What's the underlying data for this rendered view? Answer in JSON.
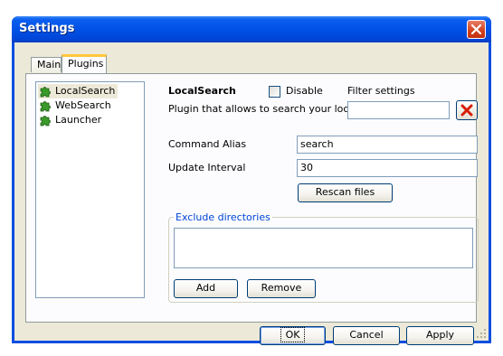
{
  "window": {
    "title": "Settings"
  },
  "tabs": [
    {
      "label": "Main",
      "active": false
    },
    {
      "label": "Plugins",
      "active": true
    }
  ],
  "plugins": [
    {
      "label": "LocalSearch",
      "icon": "puzzle-icon",
      "selected": true
    },
    {
      "label": "WebSearch",
      "icon": "puzzle-icon",
      "selected": false
    },
    {
      "label": "Launcher",
      "icon": "puzzle-icon",
      "selected": false
    }
  ],
  "plugin_detail": {
    "name": "LocalSearch",
    "description": "Plugin that allows to search your local",
    "disable_label": "Disable",
    "disable_checked": false,
    "filter_label": "Filter settings",
    "filter_value": ""
  },
  "fields": {
    "command_alias_label": "Command Alias",
    "command_alias_value": "search",
    "update_interval_label": "Update Interval",
    "update_interval_value": "30"
  },
  "buttons": {
    "rescan": "Rescan files",
    "add": "Add",
    "remove": "Remove",
    "ok": "OK",
    "cancel": "Cancel",
    "apply": "Apply"
  },
  "exclude": {
    "legend": "Exclude directories",
    "items": []
  },
  "colors": {
    "titlebar": "#0052e6",
    "close_button": "#d2401c",
    "tab_highlight": "#ffc83c",
    "group_legend": "#0046d5",
    "dialog_face": "#ece9d8"
  }
}
